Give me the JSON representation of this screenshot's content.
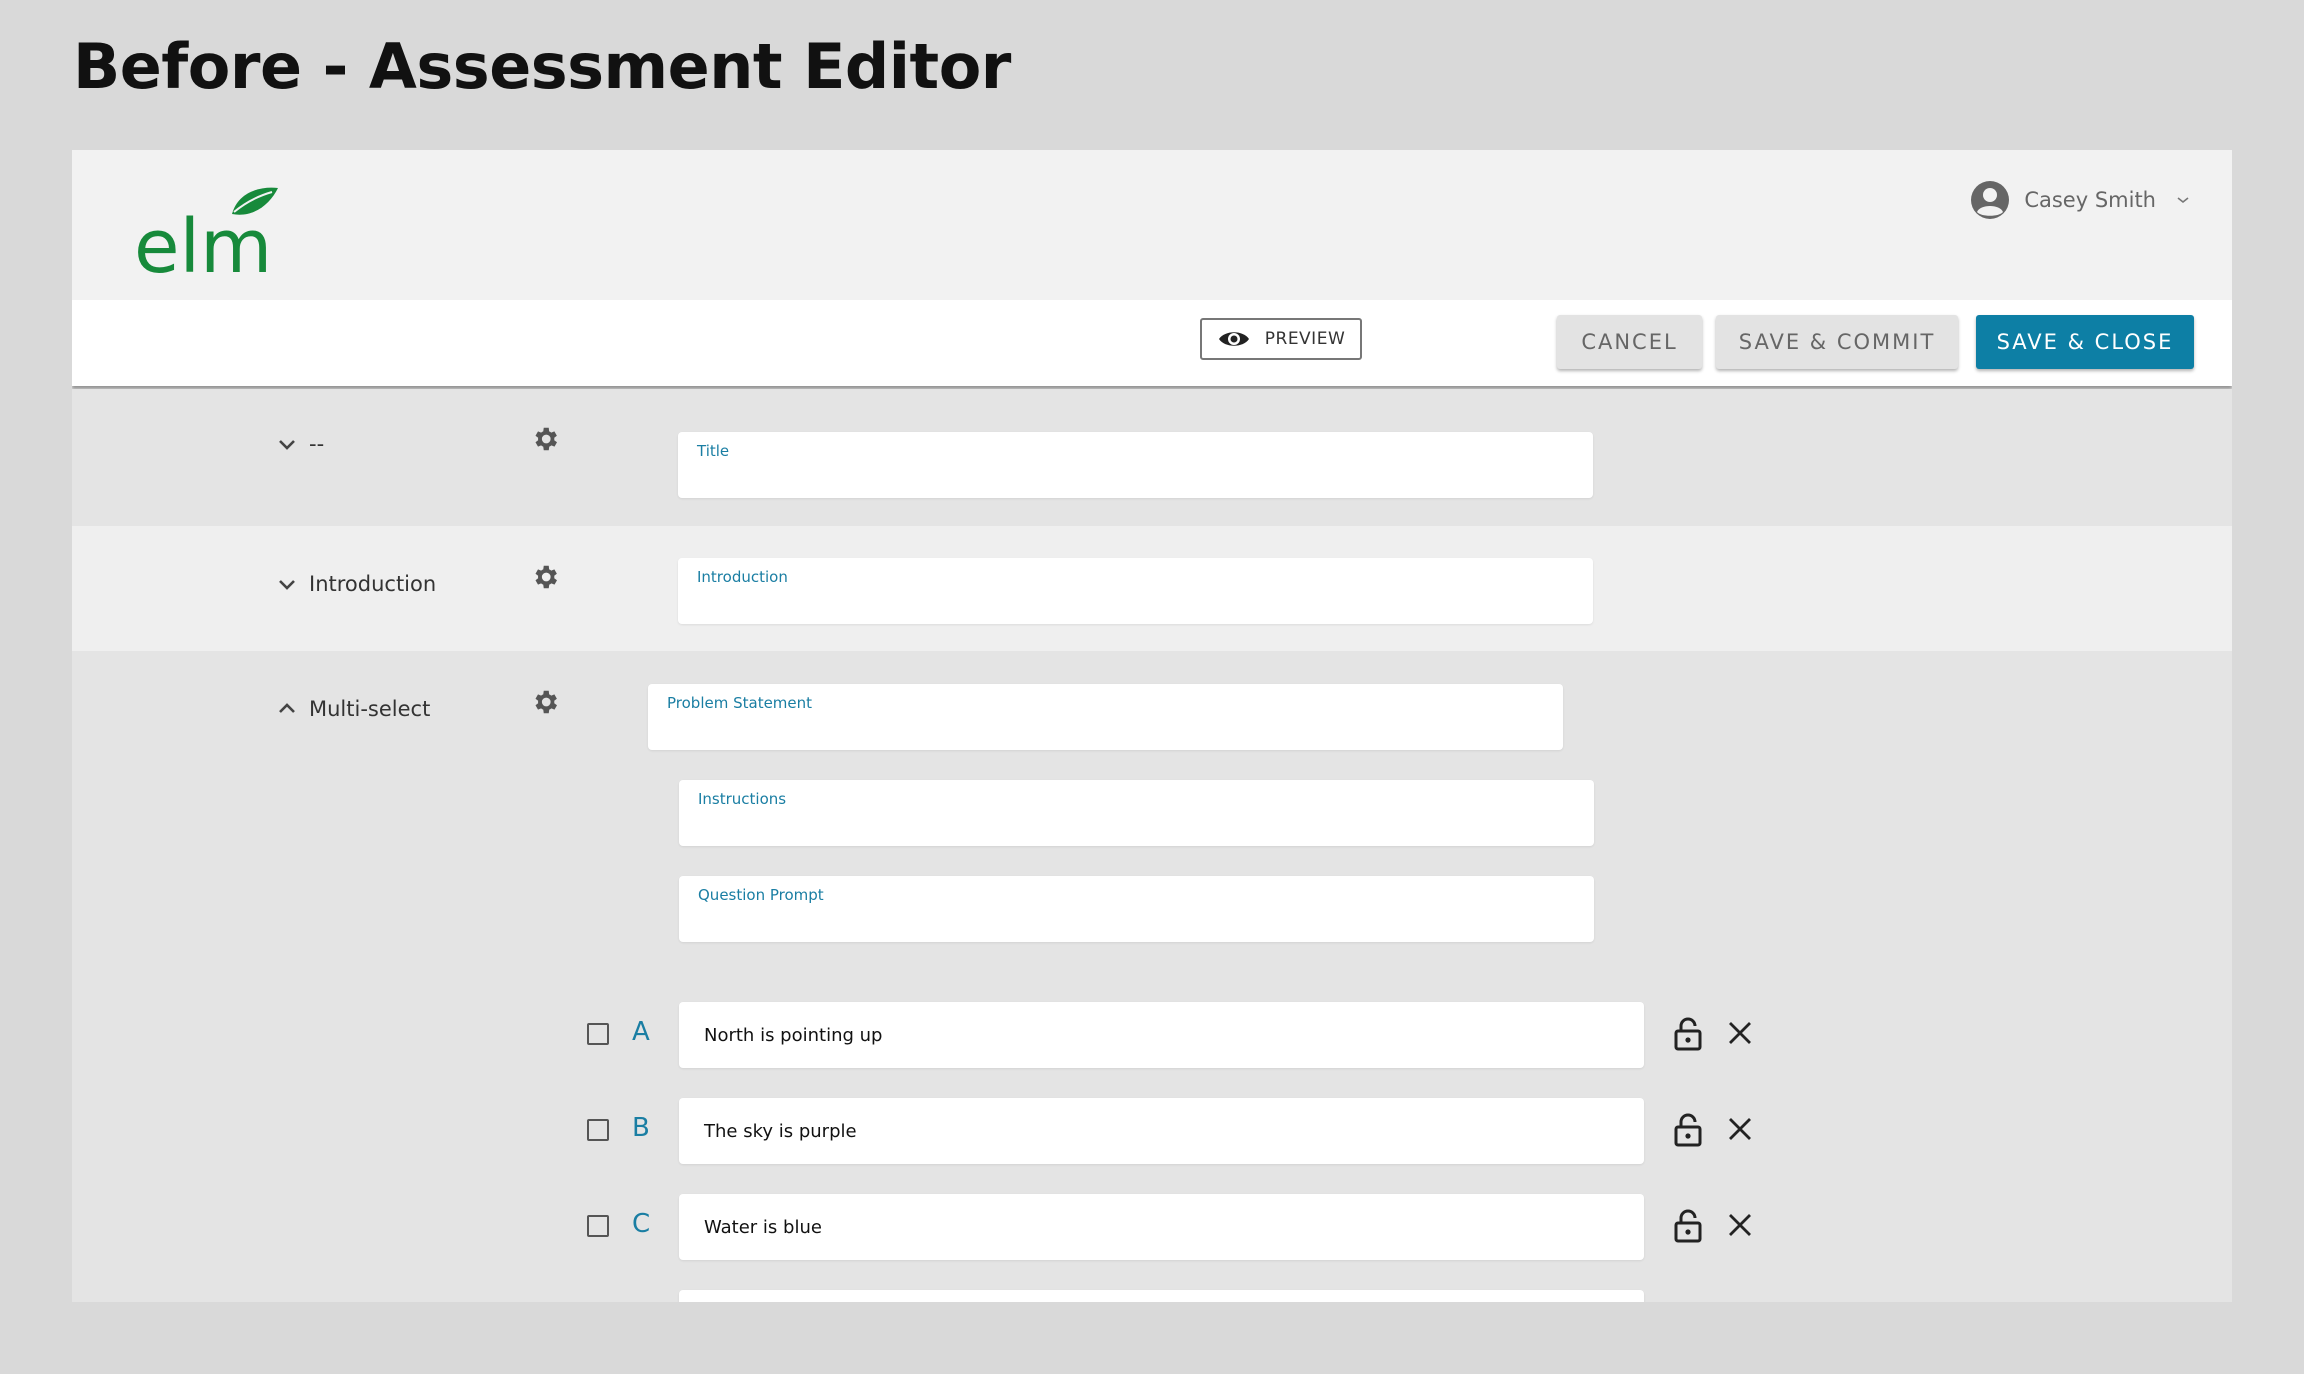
{
  "page_heading": "Before - Assessment Editor",
  "brand": {
    "logo_text": "elm",
    "logo_color": "#178a3b"
  },
  "user": {
    "name": "Casey Smith"
  },
  "toolbar": {
    "preview_label": "PREVIEW",
    "cancel_label": "CANCEL",
    "save_commit_label": "SAVE & COMMIT",
    "save_close_label": "SAVE & CLOSE",
    "accent_color": "#0d7fa5"
  },
  "outline": [
    {
      "label": "--",
      "expanded": true
    },
    {
      "label": "Introduction",
      "expanded": true
    },
    {
      "label": "Multi-select",
      "expanded": false
    }
  ],
  "fields": {
    "title": {
      "label": "Title",
      "value": ""
    },
    "introduction": {
      "label": "Introduction",
      "value": ""
    },
    "problem_statement": {
      "label": "Problem Statement",
      "value": ""
    },
    "instructions": {
      "label": "Instructions",
      "value": ""
    },
    "question_prompt": {
      "label": "Question Prompt",
      "value": ""
    }
  },
  "choices": [
    {
      "letter": "A",
      "text": "North is pointing up",
      "checked": false
    },
    {
      "letter": "B",
      "text": "The sky is purple",
      "checked": false
    },
    {
      "letter": "C",
      "text": "Water is blue",
      "checked": false
    }
  ]
}
